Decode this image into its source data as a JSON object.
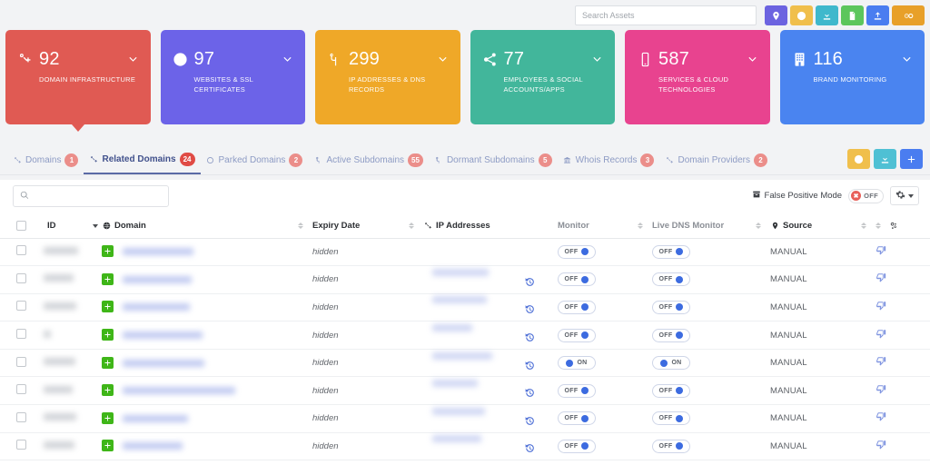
{
  "topbar": {
    "search_placeholder": "Search Assets",
    "search_value": "",
    "buttons": [
      {
        "name": "location-pin-button",
        "icon": "map-pin-icon",
        "color": "#6c63e0"
      },
      {
        "name": "info-button",
        "icon": "info-circle-icon",
        "color": "#f0bf4c"
      },
      {
        "name": "download-button",
        "icon": "download-icon",
        "color": "#3fb8cc"
      },
      {
        "name": "report-file-button",
        "icon": "file-report-icon",
        "color": "#5cc65c"
      },
      {
        "name": "upload-button",
        "icon": "upload-icon",
        "color": "#4a7df0"
      },
      {
        "name": "credits-button",
        "icon": "coin-clock-icon",
        "color": "#e8a029"
      }
    ]
  },
  "cards": [
    {
      "count": "92",
      "label": "DOMAIN INFRASTRUCTURE",
      "color": "#e05a53",
      "icon": "link-chain-icon",
      "active": true
    },
    {
      "count": "97",
      "label": "WEBSITES & SSL CERTIFICATES",
      "color": "#6c63e8",
      "icon": "globe-icon",
      "active": false
    },
    {
      "count": "299",
      "label": "IP ADDRESSES & DNS RECORDS",
      "color": "#efa828",
      "icon": "sitemap-icon",
      "active": false
    },
    {
      "count": "77",
      "label": "EMPLOYEES & SOCIAL ACCOUNTS/APPS",
      "color": "#42b69b",
      "icon": "share-nodes-icon",
      "active": false
    },
    {
      "count": "587",
      "label": "SERVICES & CLOUD TECHNOLOGIES",
      "color": "#e8438f",
      "icon": "mobile-icon",
      "active": false
    },
    {
      "count": "116",
      "label": "BRAND MONITORING",
      "color": "#4a84f0",
      "icon": "building-icon",
      "active": false
    }
  ],
  "tabs": [
    {
      "label": "Domains",
      "badge": "1",
      "icon": "link-icon",
      "active": false
    },
    {
      "label": "Related Domains",
      "badge": "24",
      "icon": "link-icon",
      "active": true
    },
    {
      "label": "Parked Domains",
      "badge": "2",
      "icon": "circle-icon",
      "active": false
    },
    {
      "label": "Active Subdomains",
      "badge": "55",
      "icon": "branch-icon",
      "active": false
    },
    {
      "label": "Dormant Subdomains",
      "badge": "5",
      "icon": "branch-icon",
      "active": false
    },
    {
      "label": "Whois Records",
      "badge": "3",
      "icon": "bank-icon",
      "active": false
    },
    {
      "label": "Domain Providers",
      "badge": "2",
      "icon": "link-icon",
      "active": false
    }
  ],
  "tab_actions": [
    {
      "name": "info-action-button",
      "icon": "info-circle-icon",
      "color": "#f0bf4c"
    },
    {
      "name": "download-action-button",
      "icon": "download-icon",
      "color": "#4fc0d4"
    },
    {
      "name": "add-action-button",
      "icon": "plus-icon",
      "color": "#4a7df0"
    }
  ],
  "filter": {
    "search_value": "",
    "search_placeholder": "",
    "false_positive_label": "False Positive Mode",
    "false_positive_state": "OFF",
    "false_positive_mark": "✖",
    "settings_button": "column-settings-button"
  },
  "table": {
    "columns": [
      {
        "key": "checkbox",
        "label": "",
        "icon": null,
        "sortable": false,
        "muted": false
      },
      {
        "key": "id",
        "label": "ID",
        "icon": null,
        "sortable": true,
        "muted": false
      },
      {
        "key": "domain",
        "label": "Domain",
        "icon": "globe-icon",
        "sortable": true,
        "muted": false
      },
      {
        "key": "expiry",
        "label": "Expiry Date",
        "icon": null,
        "sortable": true,
        "muted": false
      },
      {
        "key": "ip",
        "label": "IP Addresses",
        "icon": "link-icon",
        "sortable": false,
        "muted": false
      },
      {
        "key": "monitor",
        "label": "Monitor",
        "icon": null,
        "sortable": true,
        "muted": true
      },
      {
        "key": "livedns",
        "label": "Live DNS Monitor",
        "icon": null,
        "sortable": true,
        "muted": true
      },
      {
        "key": "source",
        "label": "Source",
        "icon": "map-pin-icon",
        "sortable": true,
        "muted": false
      },
      {
        "key": "actions",
        "label": "",
        "icon": "gear-icon",
        "sortable": false,
        "muted": false
      }
    ],
    "rows": [
      {
        "id_redacted": true,
        "id_w": 38,
        "domain_redacted": true,
        "domain_w": 78,
        "expiry": "hidden",
        "ip_redacted": false,
        "ip_w": 0,
        "has_history": false,
        "monitor": "OFF",
        "live_dns": "OFF",
        "source": "MANUAL"
      },
      {
        "id_redacted": true,
        "id_w": 33,
        "domain_redacted": true,
        "domain_w": 76,
        "expiry": "hidden",
        "ip_redacted": true,
        "ip_w": 62,
        "has_history": true,
        "monitor": "OFF",
        "live_dns": "OFF",
        "source": "MANUAL"
      },
      {
        "id_redacted": true,
        "id_w": 36,
        "domain_redacted": true,
        "domain_w": 74,
        "expiry": "hidden",
        "ip_redacted": true,
        "ip_w": 60,
        "has_history": true,
        "monitor": "OFF",
        "live_dns": "OFF",
        "source": "MANUAL"
      },
      {
        "id_redacted": true,
        "id_w": 8,
        "domain_redacted": true,
        "domain_w": 88,
        "expiry": "hidden",
        "ip_redacted": true,
        "ip_w": 44,
        "has_history": true,
        "monitor": "OFF",
        "live_dns": "OFF",
        "source": "MANUAL"
      },
      {
        "id_redacted": true,
        "id_w": 35,
        "domain_redacted": true,
        "domain_w": 90,
        "expiry": "hidden",
        "ip_redacted": true,
        "ip_w": 66,
        "has_history": true,
        "monitor": "ON",
        "live_dns": "ON",
        "source": "MANUAL"
      },
      {
        "id_redacted": true,
        "id_w": 32,
        "domain_redacted": true,
        "domain_w": 124,
        "expiry": "hidden",
        "ip_redacted": true,
        "ip_w": 50,
        "has_history": true,
        "monitor": "OFF",
        "live_dns": "OFF",
        "source": "MANUAL"
      },
      {
        "id_redacted": true,
        "id_w": 36,
        "domain_redacted": true,
        "domain_w": 72,
        "expiry": "hidden",
        "ip_redacted": true,
        "ip_w": 58,
        "has_history": true,
        "monitor": "OFF",
        "live_dns": "OFF",
        "source": "MANUAL"
      },
      {
        "id_redacted": true,
        "id_w": 34,
        "domain_redacted": true,
        "domain_w": 66,
        "expiry": "hidden",
        "ip_redacted": true,
        "ip_w": 54,
        "has_history": true,
        "monitor": "OFF",
        "live_dns": "OFF",
        "source": "MANUAL"
      }
    ]
  }
}
